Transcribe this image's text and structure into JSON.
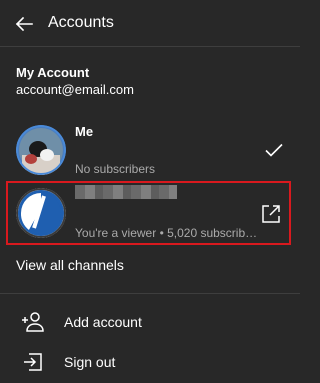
{
  "header": {
    "title": "Accounts",
    "back_icon": "arrow-left-icon"
  },
  "account": {
    "heading": "My Account",
    "email": "account@email.com"
  },
  "channels": [
    {
      "name": "Me",
      "subtitle": "No subscribers",
      "selected": true,
      "status_icon": "checkmark-icon"
    },
    {
      "name": "",
      "name_redacted": true,
      "subtitle": "You're a viewer • 5,020 subscribe…",
      "selected": false,
      "status_icon": "open-external-icon"
    }
  ],
  "view_all_label": "View all channels",
  "menu": [
    {
      "label": "Add account",
      "icon": "add-person-icon"
    },
    {
      "label": "Sign out",
      "icon": "sign-out-icon"
    }
  ],
  "colors": {
    "background": "#282828",
    "divider": "#3e3e3e",
    "secondary_text": "#aaaaaa",
    "highlight": "#d9191e"
  }
}
